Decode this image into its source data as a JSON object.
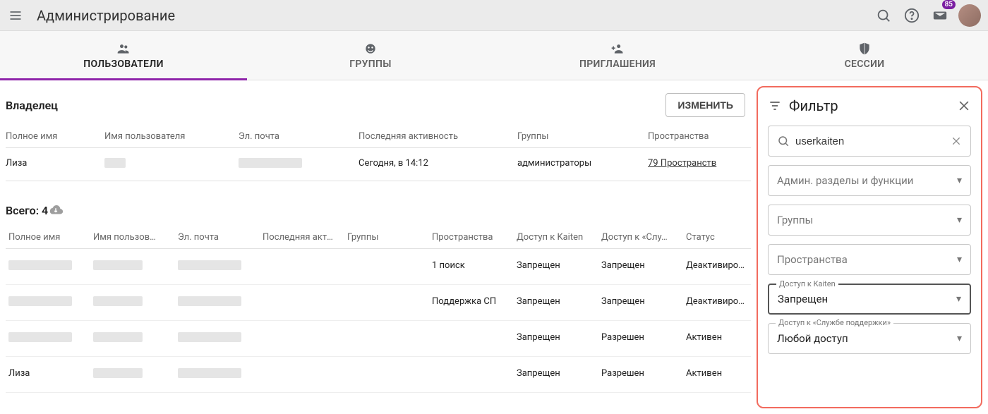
{
  "header": {
    "title": "Администрирование",
    "badge_count": "85"
  },
  "tabs": [
    {
      "label": "ПОЛЬЗОВАТЕЛИ",
      "active": true
    },
    {
      "label": "ГРУППЫ",
      "active": false
    },
    {
      "label": "ПРИГЛАШЕНИЯ",
      "active": false
    },
    {
      "label": "СЕССИИ",
      "active": false
    }
  ],
  "owner_section": {
    "title": "Владелец",
    "change_button": "ИЗМЕНИТЬ",
    "columns": {
      "full_name": "Полное имя",
      "username": "Имя пользователя",
      "email": "Эл. почта",
      "last_activity": "Последняя активность",
      "groups": "Группы",
      "spaces": "Пространства"
    },
    "row": {
      "full_name": "Лиза",
      "last_activity": "Сегодня, в 14:12",
      "groups": "администраторы",
      "spaces": "79 Пространств"
    }
  },
  "users_section": {
    "total_label": "Всего: 4",
    "columns": {
      "full_name": "Полное имя",
      "username": "Имя пользов…",
      "email": "Эл. почта",
      "last_activity": "Последняя акт…",
      "groups": "Группы",
      "spaces": "Пространства",
      "kaiten_access": "Доступ к Kaiten",
      "support_access": "Доступ к «Слу…",
      "status": "Статус"
    },
    "rows": [
      {
        "full_name": "",
        "spaces": "1 поиск",
        "kaiten": "Запрещен",
        "support": "Запрещен",
        "status": "Деактивиров…"
      },
      {
        "full_name": "",
        "spaces": "Поддержка СП",
        "kaiten": "Запрещен",
        "support": "Запрещен",
        "status": "Деактивиров…"
      },
      {
        "full_name": "",
        "spaces": "",
        "kaiten": "Запрещен",
        "support": "Разрешен",
        "status": "Активен"
      },
      {
        "full_name": "Лиза",
        "spaces": "",
        "kaiten": "Запрещен",
        "support": "Разрешен",
        "status": "Активен"
      }
    ]
  },
  "filter": {
    "title": "Фильтр",
    "search_value": "userkaiten",
    "admin_sections": "Админ. разделы и функции",
    "groups": "Группы",
    "spaces": "Пространства",
    "kaiten_access_label": "Доступ к Kaiten",
    "kaiten_access_value": "Запрещен",
    "support_access_label": "Доступ к «Службе поддержки»",
    "support_access_value": "Любой доступ"
  }
}
